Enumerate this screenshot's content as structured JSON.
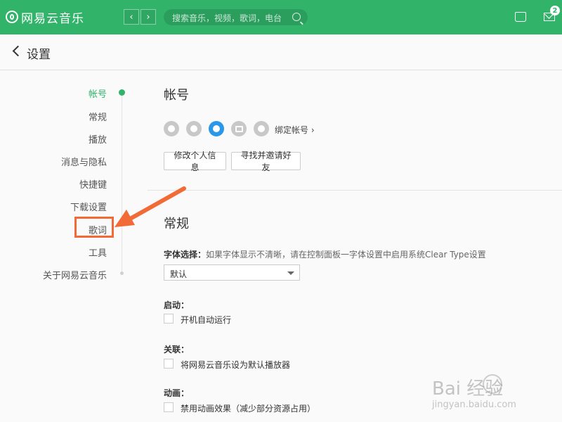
{
  "app": {
    "title": "网易云音乐"
  },
  "topbar": {
    "search_placeholder": "搜索音乐，视频，歌词，电台",
    "back_arrow": "‹",
    "forward_arrow": "›",
    "mail_badge": "2",
    "accent": "#31b46a"
  },
  "header": {
    "title": "设置"
  },
  "sidebar": {
    "items": [
      {
        "label": "帐号",
        "active": true
      },
      {
        "label": "常规"
      },
      {
        "label": "播放"
      },
      {
        "label": "消息与隐私"
      },
      {
        "label": "快捷键"
      },
      {
        "label": "下载设置"
      },
      {
        "label": "歌词"
      },
      {
        "label": "工具"
      },
      {
        "label": "关于网易云音乐"
      }
    ]
  },
  "account": {
    "title": "帐号",
    "social_icons": [
      "weibo-icon",
      "wechat-icon",
      "qq-icon",
      "douban-icon",
      "renren-icon"
    ],
    "bind_link": "绑定帐号 ›",
    "edit_profile": "修改个人信息",
    "find_friends": "寻找并邀请好友"
  },
  "general": {
    "title": "常规",
    "font_label": "字体选择：",
    "font_hint": "如果字体显示不清晰，请在控制面板一字体设置中启用系统Clear Type设置",
    "font_value": "默认",
    "startup_label": "启动：",
    "startup_option": "开机自动运行",
    "assoc_label": "关联：",
    "assoc_option": "将网易云音乐设为默认播放器",
    "anim_label": "动画：",
    "anim_option": "禁用动画效果（减少部分资源占用）"
  },
  "watermark": {
    "line1": "Bai  经验",
    "line2": "jingyan.baidu.com"
  },
  "annotation_color": "#f26a35"
}
